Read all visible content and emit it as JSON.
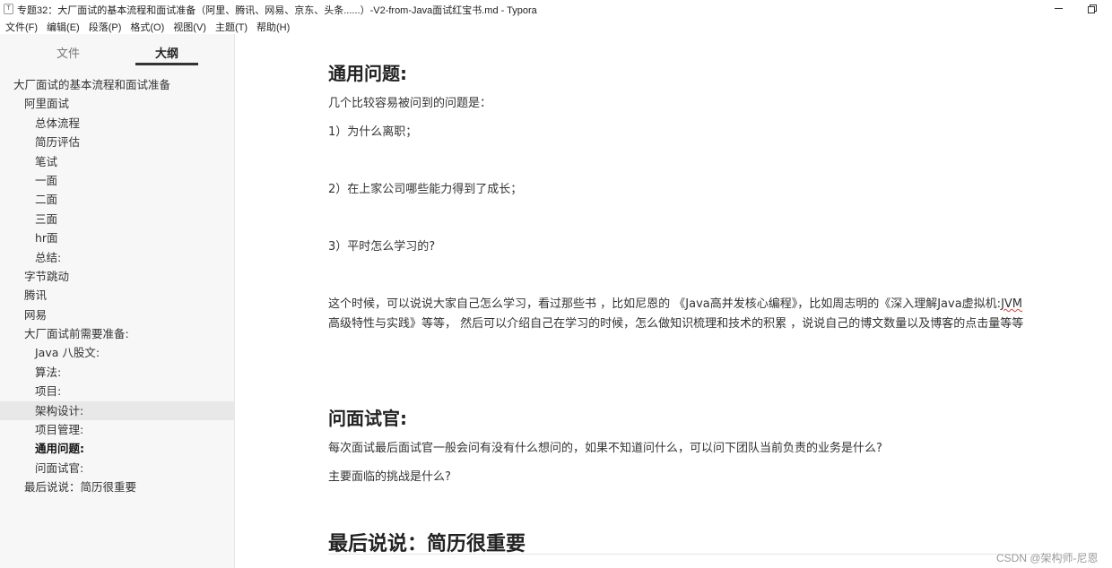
{
  "window": {
    "title": "专题32：大厂面试的基本流程和面试准备（阿里、腾讯、网易、京东、头条......）-V2-from-Java面试红宝书.md - Typora",
    "app_icon": "T"
  },
  "menu": [
    "文件(F)",
    "编辑(E)",
    "段落(P)",
    "格式(O)",
    "视图(V)",
    "主题(T)",
    "帮助(H)"
  ],
  "sidebar": {
    "tabs": [
      "文件",
      "大纲"
    ],
    "active_tab": "大纲",
    "outline": [
      {
        "label": "大厂面试的基本流程和面试准备",
        "level": 1
      },
      {
        "label": "阿里面试",
        "level": 2
      },
      {
        "label": "总体流程",
        "level": 3
      },
      {
        "label": "简历评估",
        "level": 3
      },
      {
        "label": "笔试",
        "level": 3
      },
      {
        "label": "一面",
        "level": 3
      },
      {
        "label": "二面",
        "level": 3
      },
      {
        "label": "三面",
        "level": 3
      },
      {
        "label": "hr面",
        "level": 3
      },
      {
        "label": "总结:",
        "level": 3
      },
      {
        "label": "字节跳动",
        "level": 2
      },
      {
        "label": "腾讯",
        "level": 2
      },
      {
        "label": "网易",
        "level": 2
      },
      {
        "label": "大厂面试前需要准备:",
        "level": 2
      },
      {
        "label": "Java 八股文:",
        "level": 3
      },
      {
        "label": "算法:",
        "level": 3
      },
      {
        "label": "项目:",
        "level": 3
      },
      {
        "label": "架构设计:",
        "level": 3,
        "hover": true
      },
      {
        "label": "项目管理:",
        "level": 3
      },
      {
        "label": "通用问题:",
        "level": 3,
        "active": true
      },
      {
        "label": "问面试官:",
        "level": 3
      },
      {
        "label": "最后说说：简历很重要",
        "level": 2
      }
    ]
  },
  "editor": {
    "h_general": "通用问题:",
    "p_intro": "几个比较容易被问到的问题是：",
    "p_q1": "1）为什么离职；",
    "p_q2": "2）在上家公司哪些能力得到了成长；",
    "p_q3": "3）平时怎么学习的?",
    "p_long_1a": "这个时候，可以说说大家自己怎么学习，看过那些书 ，比如尼恩的 《Java高并发核心编程》，比如周志明的《深入理解Java虚拟机:",
    "p_long_1b": "JVM",
    "p_long_2": "高级特性与实践》等等， 然后可以介绍自己在学习的时候，怎么做知识梳理和技术的积累 ，说说自己的博文数量以及博客的点击量等等",
    "h_ask": "问面试官:",
    "p_ask1": "每次面试最后面试官一般会问有没有什么想问的，如果不知道问什么，可以问下团队当前负责的业务是什么?",
    "p_ask2": "主要面临的挑战是什么?",
    "h_last": "最后说说：简历很重要"
  },
  "watermark": "CSDN @架构师-尼恩"
}
